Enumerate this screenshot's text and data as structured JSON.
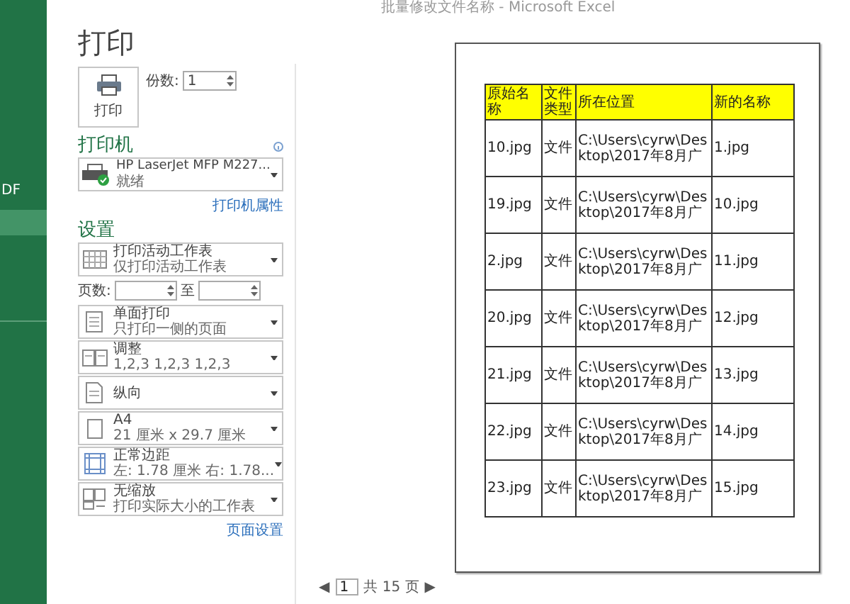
{
  "window": {
    "title": "批量修改文件名称 - Microsoft Excel"
  },
  "sidebar": {
    "items": [
      {
        "label": "DF",
        "selected": false
      },
      {
        "selected": true
      }
    ]
  },
  "print": {
    "heading": "打印",
    "button": "打印",
    "copies_label": "份数:",
    "copies": "1"
  },
  "printer": {
    "heading": "打印机",
    "name": "HP LaserJet MFP M227...",
    "status": "就绪",
    "properties_link": "打印机属性"
  },
  "settings": {
    "heading": "设置",
    "items": [
      {
        "kind": "sheet",
        "title": "打印活动工作表",
        "subtitle": "仅打印活动工作表"
      },
      {
        "kind": "pages",
        "label": "页数:",
        "to": "至"
      },
      {
        "kind": "duplex",
        "title": "单面打印",
        "subtitle": "只打印一侧的页面"
      },
      {
        "kind": "collate",
        "title": "调整",
        "subtitle": "1,2,3    1,2,3    1,2,3"
      },
      {
        "kind": "orientation",
        "title": "纵向"
      },
      {
        "kind": "paper",
        "title": "A4",
        "subtitle": "21 厘米 x 29.7 厘米"
      },
      {
        "kind": "margins",
        "title": "正常边距",
        "subtitle": "左: 1.78 厘米    右: 1.78..."
      },
      {
        "kind": "scaling",
        "title": "无缩放",
        "subtitle": "打印实际大小的工作表"
      }
    ],
    "page_setup_link": "页面设置"
  },
  "preview": {
    "columns": [
      "原始名称",
      "文件类型",
      "所在位置",
      "新的名称"
    ],
    "rows": [
      [
        "10.jpg",
        "文件",
        "C:\\Users\\cyrw\\Desktop\\2017年8月广",
        "1.jpg"
      ],
      [
        "19.jpg",
        "文件",
        "C:\\Users\\cyrw\\Desktop\\2017年8月广",
        "10.jpg"
      ],
      [
        "2.jpg",
        "文件",
        "C:\\Users\\cyrw\\Desktop\\2017年8月广",
        "11.jpg"
      ],
      [
        "20.jpg",
        "文件",
        "C:\\Users\\cyrw\\Desktop\\2017年8月广",
        "12.jpg"
      ],
      [
        "21.jpg",
        "文件",
        "C:\\Users\\cyrw\\Desktop\\2017年8月广",
        "13.jpg"
      ],
      [
        "22.jpg",
        "文件",
        "C:\\Users\\cyrw\\Desktop\\2017年8月广",
        "14.jpg"
      ],
      [
        "23.jpg",
        "文件",
        "C:\\Users\\cyrw\\Desktop\\2017年8月广",
        "15.jpg"
      ]
    ]
  },
  "pager": {
    "prev": "◀",
    "page": "1",
    "total": "共 15 页",
    "next": "▶"
  }
}
